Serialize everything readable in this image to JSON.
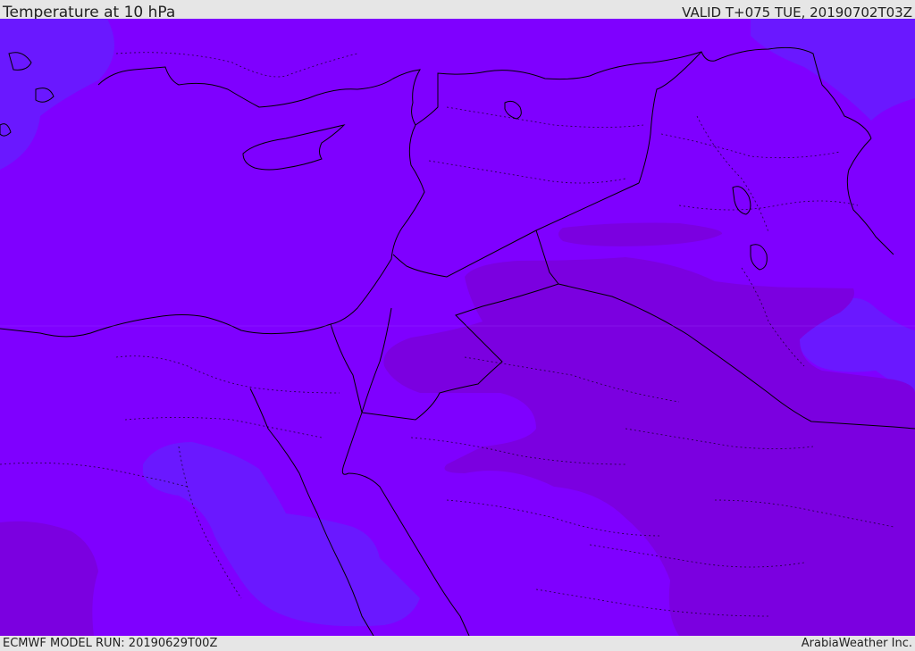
{
  "header": {
    "title": "Temperature at 10 hPa",
    "valid": "VALID T+075 TUE, 20190702T03Z"
  },
  "footer": {
    "model_run": "ECMWF MODEL RUN: 20190629T00Z",
    "credit": "ArabiaWeather Inc."
  },
  "colors": {
    "field_main": "#7f00ff",
    "field_warm": "#7b00e0",
    "field_cool": "#6a18ff",
    "border": "#000000"
  }
}
